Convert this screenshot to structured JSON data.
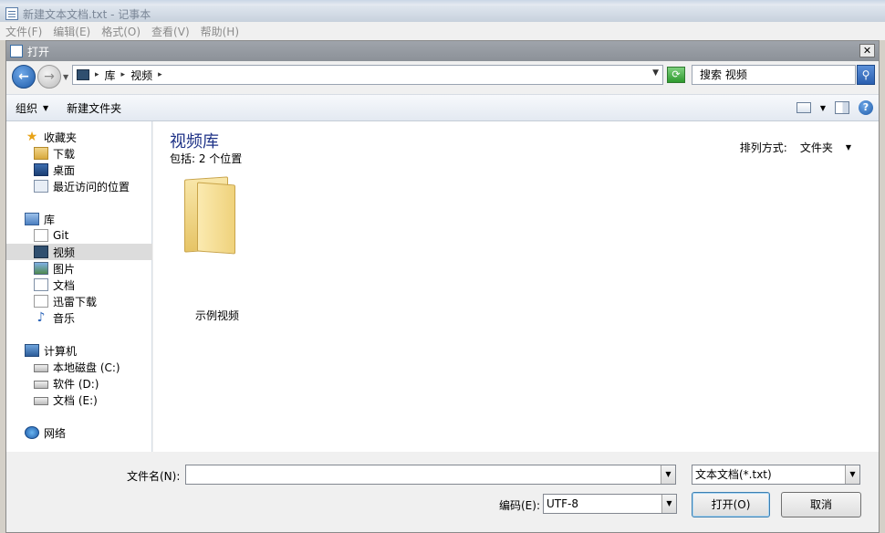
{
  "notepad": {
    "title": "新建文本文档.txt - 记事本",
    "menu": [
      "文件(F)",
      "编辑(E)",
      "格式(O)",
      "查看(V)",
      "帮助(H)"
    ]
  },
  "dialog": {
    "title": "打开",
    "close": "✕",
    "address": {
      "crumbs": [
        "库",
        "视频"
      ]
    },
    "search": {
      "placeholder": "搜索 视频"
    },
    "toolbar": {
      "organize": "组织",
      "new_folder": "新建文件夹"
    },
    "nav": {
      "favorites": {
        "label": "收藏夹",
        "items": [
          "下载",
          "桌面",
          "最近访问的位置"
        ]
      },
      "libraries": {
        "label": "库",
        "items": [
          "Git",
          "视频",
          "图片",
          "文档",
          "迅雷下载",
          "音乐"
        ]
      },
      "computer": {
        "label": "计算机",
        "items": [
          "本地磁盘 (C:)",
          "软件 (D:)",
          "文档 (E:)"
        ]
      },
      "network": {
        "label": "网络"
      },
      "selected": "视频"
    },
    "content": {
      "library_title": "视频库",
      "includes": "包括: 2 个位置",
      "sort_label": "排列方式:",
      "sort_value": "文件夹",
      "items": [
        {
          "name": "示例视频",
          "icon": "folder-icon"
        }
      ]
    },
    "footer": {
      "filename_label": "文件名(N):",
      "filename_value": "",
      "filetype_value": "文本文档(*.txt)",
      "encoding_label": "编码(E):",
      "encoding_value": "UTF-8",
      "open_button": "打开(O)",
      "cancel_button": "取消"
    }
  }
}
